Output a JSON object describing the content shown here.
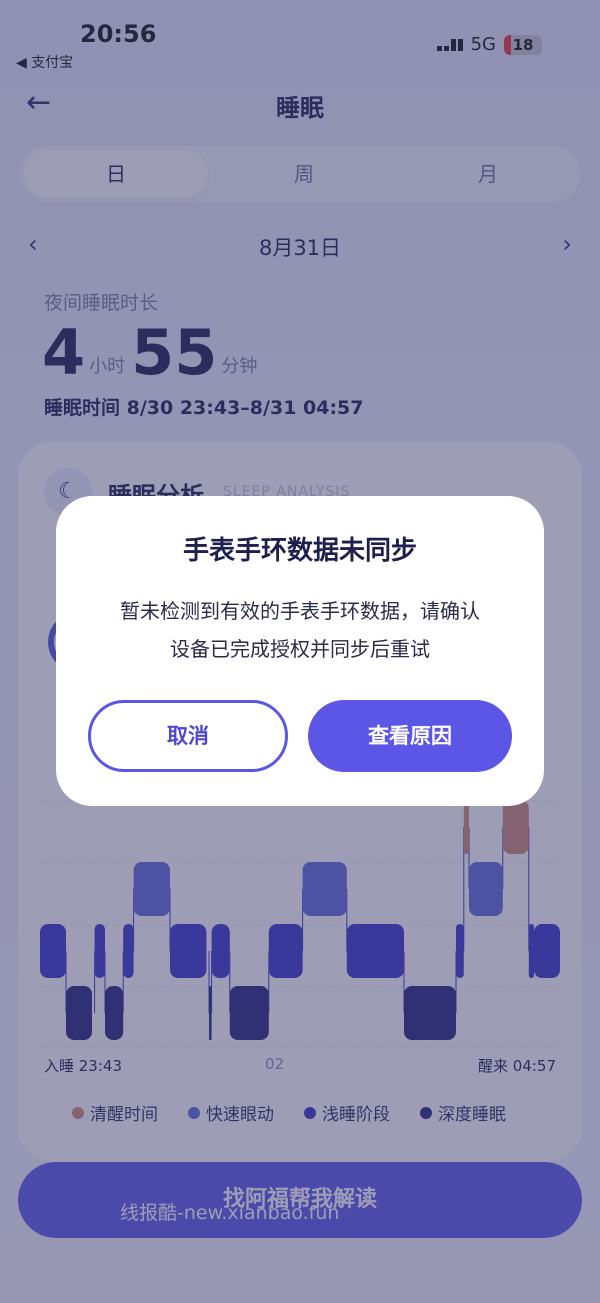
{
  "status_bar": {
    "time": "20:56",
    "back_app": "◀ 支付宝",
    "network": "5G",
    "battery": "18"
  },
  "header": {
    "title": "睡眠"
  },
  "tabs": [
    {
      "label": "日",
      "active": true
    },
    {
      "label": "周",
      "active": false
    },
    {
      "label": "月",
      "active": false
    }
  ],
  "date": {
    "label": "8月31日"
  },
  "duration": {
    "label": "夜间睡眠时长",
    "hours": "4",
    "hours_unit": "小时",
    "minutes": "55",
    "minutes_unit": "分钟",
    "sleep_time": "睡眠时间 8/30 23:43–8/31 04:57"
  },
  "analysis": {
    "title": "睡眠分析",
    "subtitle": "SLEEP ANALYSIS"
  },
  "chart_data": {
    "type": "sleep-stages",
    "x_start": "入睡 23:43",
    "x_mid": "02",
    "x_end": "醒来 04:57",
    "stages": [
      "清醒时间",
      "快速眼动",
      "浅睡阶段",
      "深度睡眠"
    ],
    "segments": [
      {
        "stage": "浅睡阶段",
        "x": [
          0.0,
          0.05
        ]
      },
      {
        "stage": "深度睡眠",
        "x": [
          0.05,
          0.1
        ]
      },
      {
        "stage": "浅睡阶段",
        "x": [
          0.105,
          0.125
        ]
      },
      {
        "stage": "深度睡眠",
        "x": [
          0.125,
          0.16
        ]
      },
      {
        "stage": "浅睡阶段",
        "x": [
          0.16,
          0.18
        ]
      },
      {
        "stage": "快速眼动",
        "x": [
          0.18,
          0.25
        ]
      },
      {
        "stage": "浅睡阶段",
        "x": [
          0.25,
          0.32
        ]
      },
      {
        "stage": "深度睡眠",
        "x": [
          0.325,
          0.33
        ]
      },
      {
        "stage": "浅睡阶段",
        "x": [
          0.33,
          0.365
        ]
      },
      {
        "stage": "深度睡眠",
        "x": [
          0.365,
          0.44
        ]
      },
      {
        "stage": "浅睡阶段",
        "x": [
          0.44,
          0.505
        ]
      },
      {
        "stage": "快速眼动",
        "x": [
          0.505,
          0.59
        ]
      },
      {
        "stage": "浅睡阶段",
        "x": [
          0.59,
          0.7
        ]
      },
      {
        "stage": "深度睡眠",
        "x": [
          0.7,
          0.8
        ]
      },
      {
        "stage": "浅睡阶段",
        "x": [
          0.8,
          0.815
        ]
      },
      {
        "stage": "清醒时间",
        "x": [
          0.815,
          0.825
        ]
      },
      {
        "stage": "快速眼动",
        "x": [
          0.825,
          0.89
        ]
      },
      {
        "stage": "清醒时间",
        "x": [
          0.89,
          0.94
        ]
      },
      {
        "stage": "浅睡阶段",
        "x": [
          0.94,
          0.95
        ]
      },
      {
        "stage": "浅睡阶段",
        "x": [
          0.95,
          1.0
        ]
      }
    ]
  },
  "legend": [
    {
      "label": "清醒时间",
      "color": "#d08a72"
    },
    {
      "label": "快速眼动",
      "color": "#5b6bd6"
    },
    {
      "label": "浅睡阶段",
      "color": "#3a34c9"
    },
    {
      "label": "深度睡眠",
      "color": "#27247a"
    }
  ],
  "cta": {
    "label": "找阿福帮我解读"
  },
  "watermark": "线报酷-new.xianbao.fun",
  "dialog": {
    "title": "手表手环数据未同步",
    "body_line1": "暂未检测到有效的手表手环数据，请确认",
    "body_line2": "设备已完成授权并同步后重试",
    "cancel_label": "取消",
    "ok_label": "查看原因"
  }
}
